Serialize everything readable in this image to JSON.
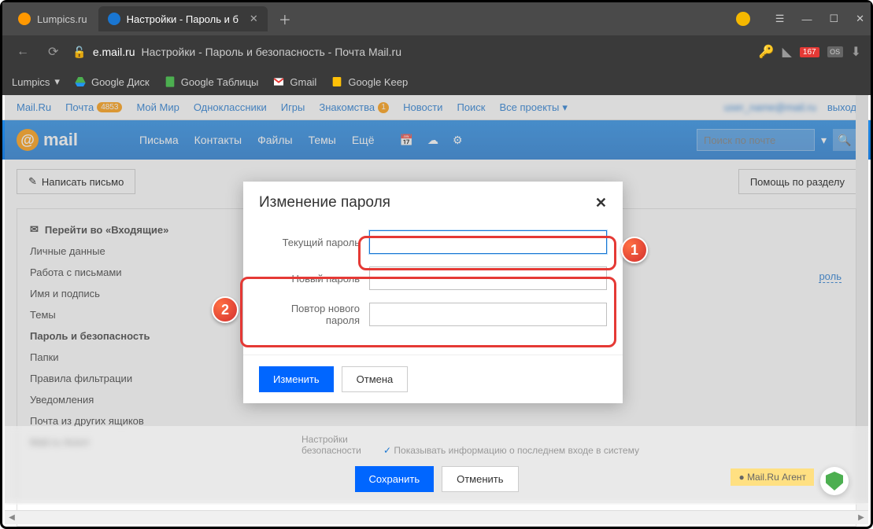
{
  "browser": {
    "tabs": [
      {
        "title": "Lumpics.ru",
        "favicon_color": "#ff9800"
      },
      {
        "title": "Настройки - Пароль и б",
        "favicon_color": "#1976d2"
      }
    ],
    "url_domain": "e.mail.ru",
    "url_path": "Настройки - Пароль и безопасность - Почта Mail.ru",
    "badge_count": "167",
    "bookmarks": [
      {
        "label": "Lumpics",
        "hasDropdown": true
      },
      {
        "label": "Google Диск"
      },
      {
        "label": "Google Таблицы"
      },
      {
        "label": "Gmail"
      },
      {
        "label": "Google Keep"
      }
    ]
  },
  "mailru_top": {
    "links": [
      {
        "label": "Mail.Ru"
      },
      {
        "label": "Почта",
        "badge": "4853"
      },
      {
        "label": "Мой Мир"
      },
      {
        "label": "Одноклассники"
      },
      {
        "label": "Игры"
      },
      {
        "label": "Знакомства",
        "round_badge": "1"
      },
      {
        "label": "Новости"
      },
      {
        "label": "Поиск"
      },
      {
        "label": "Все проекты",
        "hasDropdown": true
      }
    ],
    "logout": "выход"
  },
  "mail_header": {
    "logo": "mail",
    "nav": [
      "Письма",
      "Контакты",
      "Файлы",
      "Темы",
      "Ещё"
    ],
    "search_placeholder": "Поиск по почте"
  },
  "toolbar": {
    "compose": "Написать письмо",
    "help": "Помощь по разделу"
  },
  "sidebar": {
    "items": [
      {
        "label": "Перейти во «Входящие»",
        "bold": true,
        "icon": true
      },
      {
        "label": "Личные данные"
      },
      {
        "label": "Работа с письмами"
      },
      {
        "label": "Имя и подпись"
      },
      {
        "label": "Темы"
      },
      {
        "label": "Пароль и безопасность",
        "active": true
      },
      {
        "label": "Папки"
      },
      {
        "label": "Правила фильтрации"
      },
      {
        "label": "Уведомления"
      },
      {
        "label": "Почта из других ящиков"
      },
      {
        "label": "Mail.ru Агент"
      }
    ]
  },
  "right_pane": {
    "link": "роль"
  },
  "modal": {
    "title": "Изменение пароля",
    "fields": {
      "current": "Текущий пароль",
      "new": "Новый пароль",
      "repeat": "Повтор нового пароля"
    },
    "submit": "Изменить",
    "cancel": "Отмена"
  },
  "bottom": {
    "label_settings": "Настройки",
    "label_security": "безопасности",
    "checkbox_text": "Показывать информацию о последнем входе в систему",
    "save": "Сохранить",
    "cancel": "Отменить",
    "agent": "Mail.Ru Агент"
  },
  "annotations": {
    "n1": "1",
    "n2": "2"
  }
}
